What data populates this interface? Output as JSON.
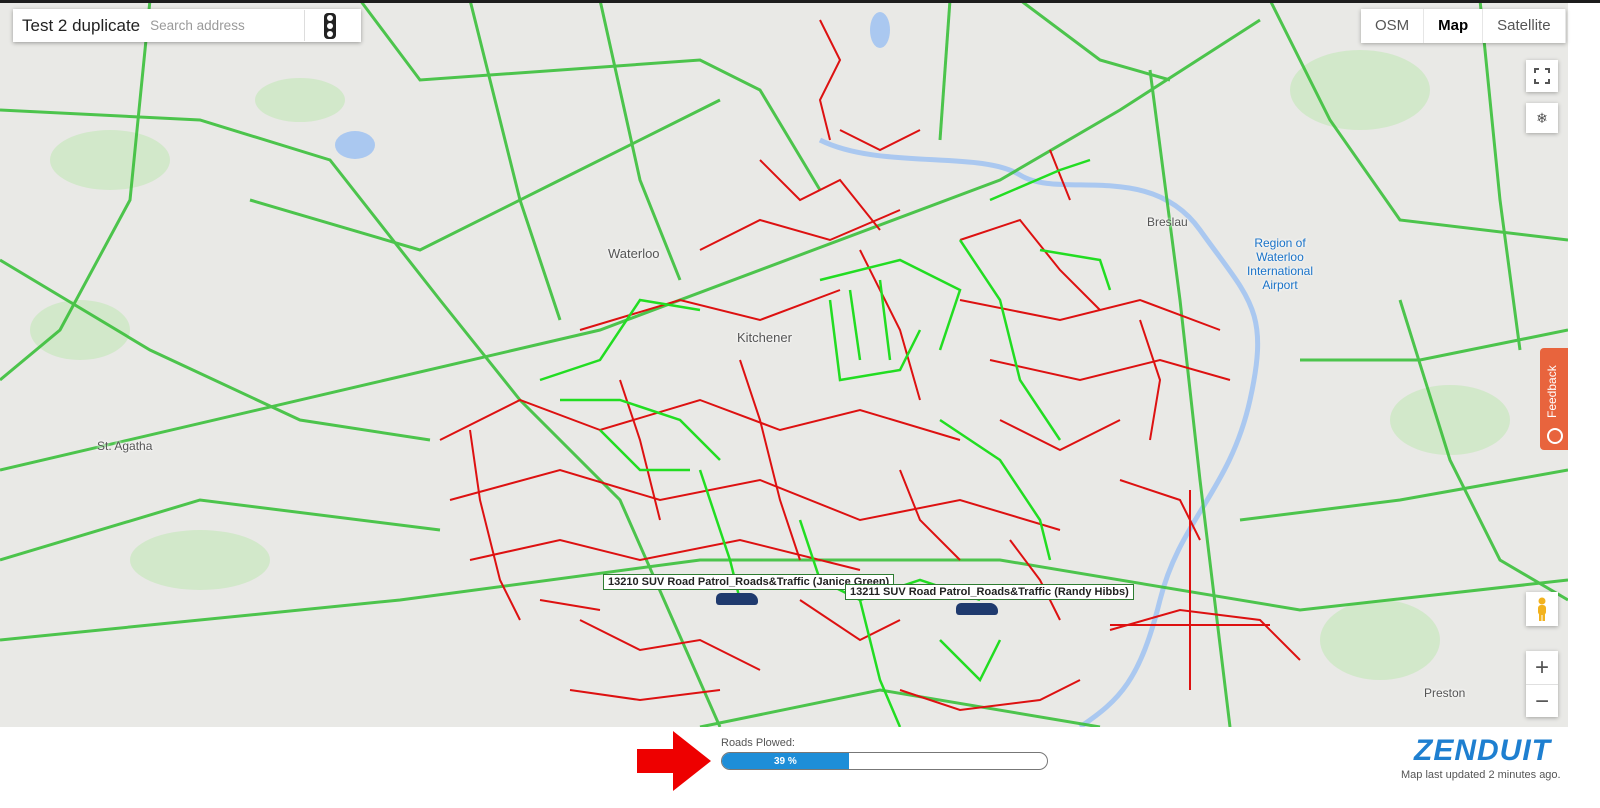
{
  "app": {
    "title": "Test 2 duplicate"
  },
  "search": {
    "placeholder": "Search address"
  },
  "map_types": [
    "OSM",
    "Map",
    "Satellite"
  ],
  "map_type_selected": "Map",
  "feedback_label": "Feedback",
  "zoom": {
    "in": "+",
    "out": "−"
  },
  "place_labels": {
    "waterloo": "Waterloo",
    "kitchener": "Kitchener",
    "breslau": "Breslau",
    "airport": "Region of Waterloo International Airport",
    "st_agatha": "St. Agatha",
    "preston": "Preston"
  },
  "vehicles": [
    {
      "label": "13210 SUV Road Patrol_Roads&Traffic (Janice Green)"
    },
    {
      "label": "13211 SUV Road Patrol_Roads&Traffic (Randy Hibbs)"
    }
  ],
  "footer": {
    "roads_plowed_label": "Roads Plowed:",
    "progress_text": "39 %",
    "progress_fraction": 0.39,
    "logo_text": "ZENDUIT",
    "updated_text": "Map last updated 2 minutes ago."
  },
  "colors": {
    "plowed": "#22dd22",
    "unplowed": "#dd1111",
    "progress": "#1e8ed8",
    "feedback": "#e8643d",
    "logo": "#1e7fd0",
    "arrow": "#ee0000"
  },
  "icons": [
    "traffic-light-icon",
    "fullscreen-icon",
    "snowflake-icon",
    "pegman-icon",
    "arrow-right-icon"
  ]
}
